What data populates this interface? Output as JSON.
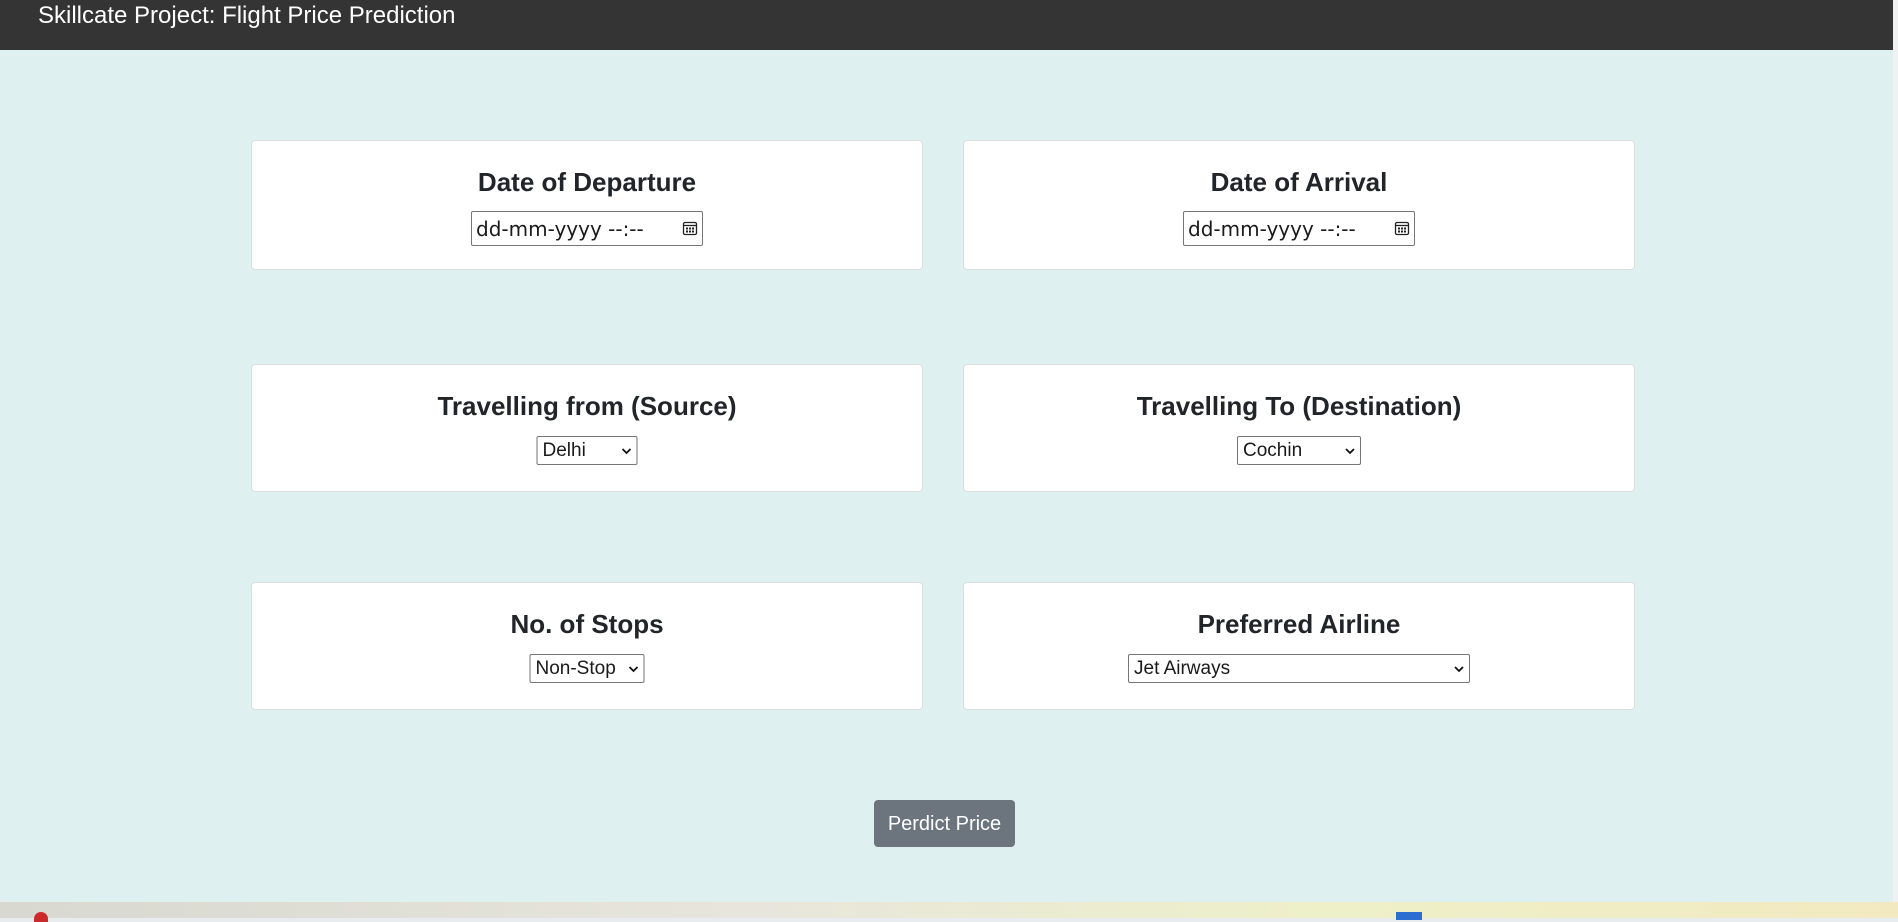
{
  "navbar": {
    "title": "Skillcate Project: Flight Price Prediction"
  },
  "departure": {
    "label": "Date of Departure",
    "placeholder": "dd-mm-yyyy  --:--"
  },
  "arrival": {
    "label": "Date of Arrival",
    "placeholder": "dd-mm-yyyy  --:--"
  },
  "source": {
    "label": "Travelling from (Source)",
    "selected": "Delhi"
  },
  "destination": {
    "label": "Travelling To (Destination)",
    "selected": "Cochin"
  },
  "stops": {
    "label": "No. of Stops",
    "selected": "Non-Stop"
  },
  "airline": {
    "label": "Preferred Airline",
    "selected": "Jet Airways"
  },
  "submit": {
    "label": "Perdict Price"
  },
  "colors": {
    "navbar": "#343434",
    "background": "#dff0f0",
    "button": "#6c757d"
  }
}
